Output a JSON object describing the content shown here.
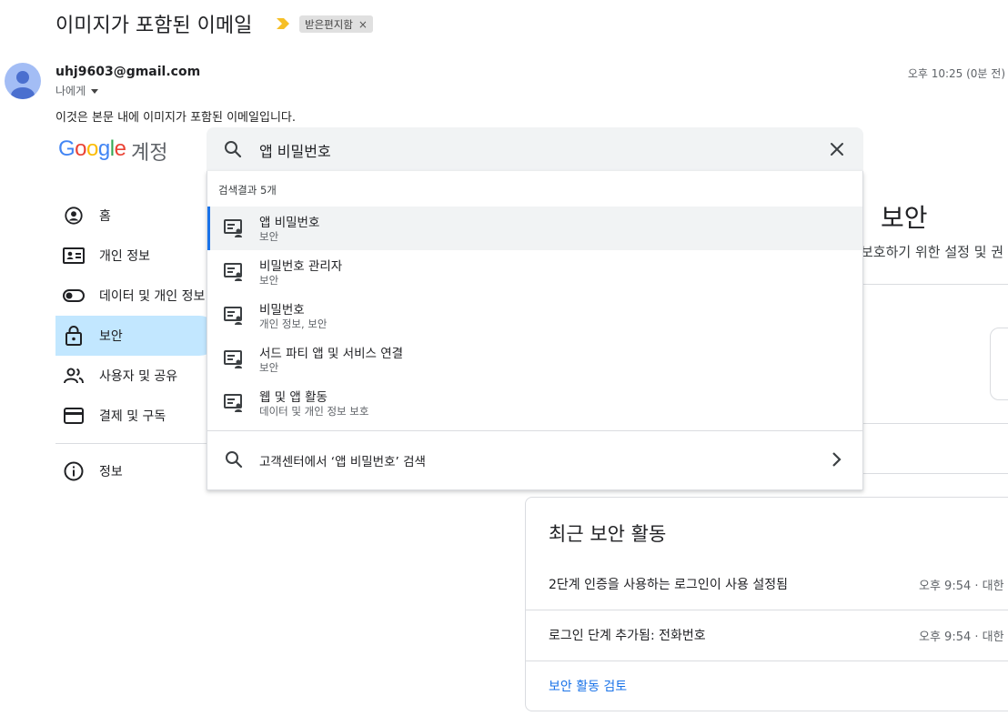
{
  "email": {
    "subject": "이미지가 포함된 이메일",
    "label": "받은편지함",
    "label_close": "×",
    "sender": "uhj9603@gmail.com",
    "recipient": "나에게",
    "timestamp": "오후 10:25 (0분 전)",
    "body": "이것은 본문 내에 이미지가 포함된 이메일입니다."
  },
  "account": {
    "logo_letters": [
      "G",
      "o",
      "o",
      "g",
      "l",
      "e"
    ],
    "logo_colors": [
      "#4285f4",
      "#ea4335",
      "#fbbc05",
      "#4285f4",
      "#34a853",
      "#ea4335"
    ],
    "title": "계정",
    "nav": [
      {
        "label": "홈",
        "icon": "account-circle-icon"
      },
      {
        "label": "개인 정보",
        "icon": "id-card-icon"
      },
      {
        "label": "데이터 및 개인 정보",
        "icon": "toggle-icon"
      },
      {
        "label": "보안",
        "icon": "lock-icon",
        "active": true
      },
      {
        "label": "사용자 및 공유",
        "icon": "people-icon"
      },
      {
        "label": "결제 및 구독",
        "icon": "credit-card-icon"
      }
    ],
    "nav_info": {
      "label": "정보",
      "icon": "info-icon"
    },
    "security_title": "보안",
    "security_subtitle": "보호하기 위한 설정 및 권"
  },
  "search": {
    "query": "앱 비밀번호",
    "result_count": "검색결과 5개",
    "results": [
      {
        "title": "앱 비밀번호",
        "category": "보안"
      },
      {
        "title": "비밀번호 관리자",
        "category": "보안"
      },
      {
        "title": "비밀번호",
        "category": "개인 정보, 보안"
      },
      {
        "title": "서드 파티 앱 및 서비스 연결",
        "category": "보안"
      },
      {
        "title": "웹 및 앱 활동",
        "category": "데이터 및 개인 정보 보호"
      }
    ],
    "help_search": "고객센터에서 ‘앱 비밀번호’ 검색"
  },
  "recent_activity": {
    "title": "최근 보안 활동",
    "items": [
      {
        "text": "2단계 인증을 사용하는 로그인이 사용 설정됨",
        "time": "오후 9:54 · 대한"
      },
      {
        "text": "로그인 단계 추가됨: 전화번호",
        "time": "오후 9:54 · 대한"
      }
    ],
    "review_link": "보안 활동 검토"
  },
  "colors": {
    "accent": "#1a73e8",
    "active_nav": "#c2e7ff",
    "important": "#f6bf26"
  }
}
